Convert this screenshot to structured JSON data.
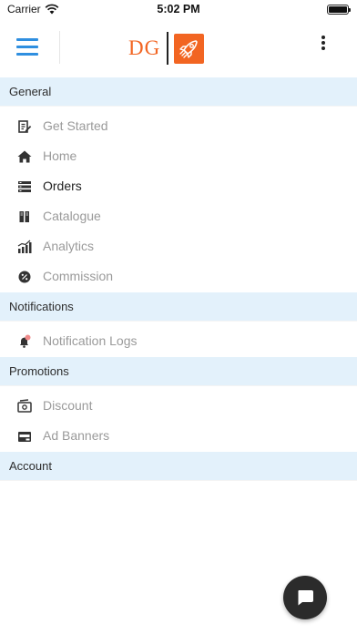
{
  "status_bar": {
    "carrier": "Carrier",
    "time": "5:02 PM"
  },
  "header": {
    "logo_text": "DG"
  },
  "menu": {
    "general": {
      "title": "General",
      "items": [
        {
          "label": "Get Started",
          "icon": "get-started-icon"
        },
        {
          "label": "Home",
          "icon": "home-icon"
        },
        {
          "label": "Orders",
          "icon": "orders-icon"
        },
        {
          "label": "Catalogue",
          "icon": "catalogue-icon"
        },
        {
          "label": "Analytics",
          "icon": "analytics-icon"
        },
        {
          "label": "Commission",
          "icon": "commission-icon"
        }
      ]
    },
    "notifications": {
      "title": "Notifications",
      "items": [
        {
          "label": "Notification Logs",
          "icon": "bell-icon"
        }
      ]
    },
    "promotions": {
      "title": "Promotions",
      "items": [
        {
          "label": "Discount",
          "icon": "discount-icon"
        },
        {
          "label": "Ad Banners",
          "icon": "ad-banner-icon"
        }
      ]
    },
    "account": {
      "title": "Account"
    }
  },
  "colors": {
    "accent": "#2f8fe0",
    "brand": "#f26522",
    "section_bg": "#e3f1fb",
    "muted_text": "#9a9a9a",
    "active_text": "#222222"
  },
  "active_item": "Orders"
}
